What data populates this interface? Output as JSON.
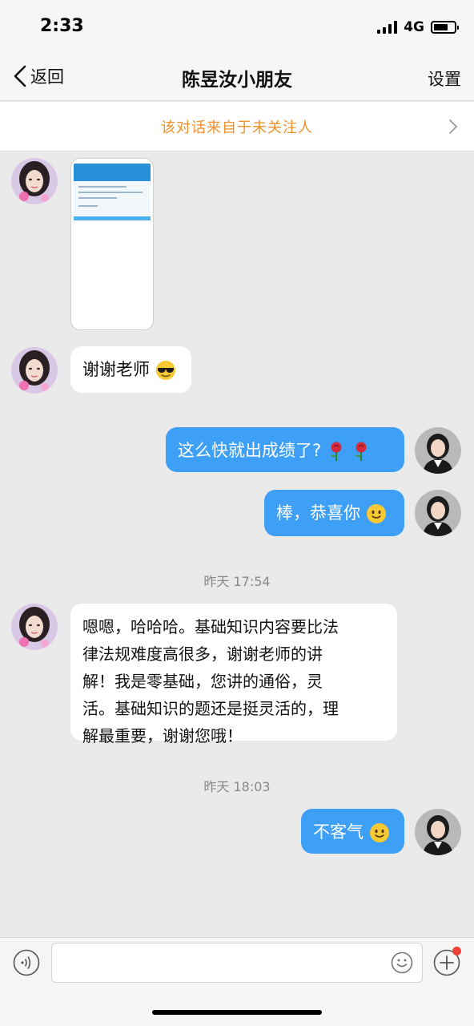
{
  "status_bar": {
    "time": "2:33",
    "network": "4G",
    "battery_level": 0.7
  },
  "nav": {
    "back_label": "返回",
    "title": "陈昱汝小朋友",
    "settings_label": "设置"
  },
  "notice": {
    "text": "该对话来自于未关注人"
  },
  "messages": {
    "m2": {
      "text": "谢谢老师"
    },
    "m3": {
      "text": "这么快就出成绩了?"
    },
    "m4": {
      "text": "棒，恭喜你"
    },
    "ts1": "昨天 17:54",
    "m5": {
      "lines": [
        "嗯嗯，哈哈哈。基础知识内容要比法",
        "律法规难度高很多，谢谢老师的讲",
        "解！我是零基础，您讲的通俗，灵",
        "活。基础知识的题还是挺灵活的，理",
        "解最重要，谢谢您哦！"
      ]
    },
    "ts2": "昨天 18:03",
    "m6": {
      "text": "不客气"
    }
  },
  "input": {
    "placeholder": ""
  },
  "colors": {
    "accent_orange": "#f0902a",
    "bubble_blue": "#3d9ff6",
    "badge_red": "#f0443a",
    "background": "#eaeaea"
  },
  "icons": {
    "back": "chevron-left-icon",
    "notice_arrow": "chevron-right-icon",
    "voice": "voice-icon",
    "emoji": "emoji-smile-icon",
    "plus": "plus-icon",
    "sunglasses": "sunglasses-emoji",
    "rose": "rose-emoji",
    "smile": "smile-emoji"
  }
}
